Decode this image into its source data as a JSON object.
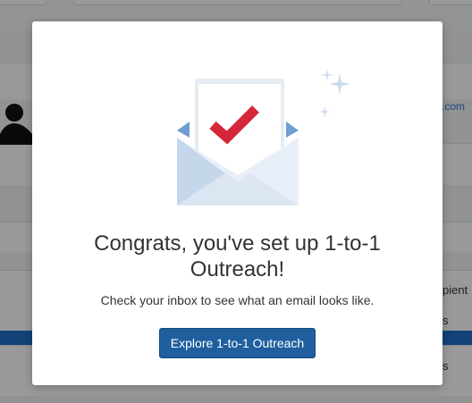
{
  "background": {
    "link_partial": ".com",
    "text_partial_1": "pient",
    "text_partial_2": "s",
    "text_partial_3": "s"
  },
  "modal": {
    "title_line1": "Congrats, you've set up 1-to-1",
    "title_line2": "Outreach!",
    "subtitle": "Check your inbox to see what an email looks like.",
    "cta_label": "Explore 1-to-1 Outreach",
    "illustration_icon": "envelope-with-checkmark-icon"
  },
  "colors": {
    "primary_button": "#1f5f9e",
    "check_red": "#d6263a",
    "envelope_light": "#e8eff8",
    "sparkle": "#c9daf0"
  }
}
